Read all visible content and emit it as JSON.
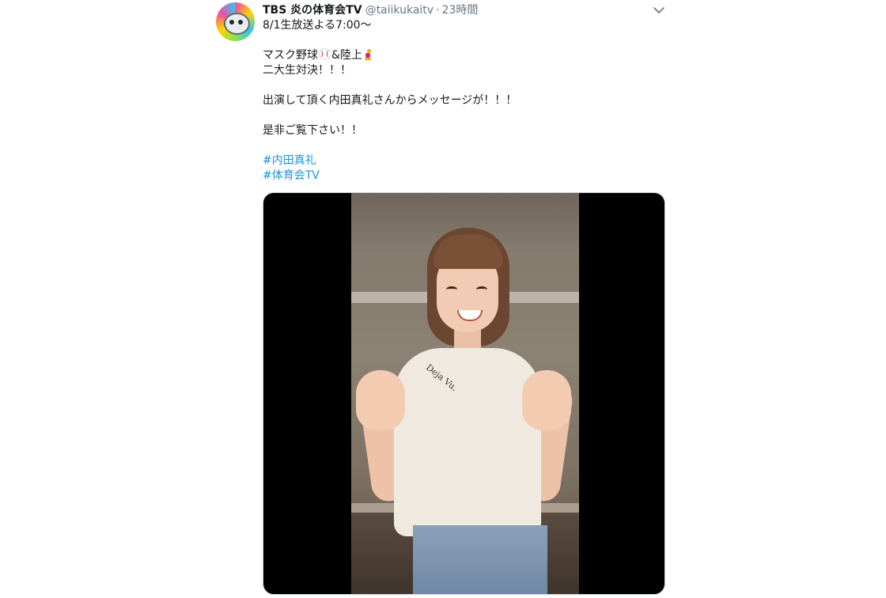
{
  "tweet": {
    "display_name": "TBS 炎の体育会TV",
    "handle": "@taiikukaitv",
    "separator": "·",
    "timestamp": "23時間",
    "menu_icon": "chevron-down-icon",
    "lines": {
      "l1": "8/1生放送よる7:00〜",
      "l2a": "マスク野球",
      "l2b": "&陸上",
      "l3": "二大生対決！！！",
      "l4": "出演して頂く内田真礼さんからメッセージが！！！",
      "l5": "是非ご覧下さい！！"
    },
    "emojis": [
      "baseball-emoji",
      "runner-emoji"
    ],
    "hashtags": [
      "#内田真礼",
      "#体育会TV"
    ],
    "link_color": "#1b95e0"
  },
  "media": {
    "type": "video",
    "shirt_print": "Deja Vu."
  }
}
